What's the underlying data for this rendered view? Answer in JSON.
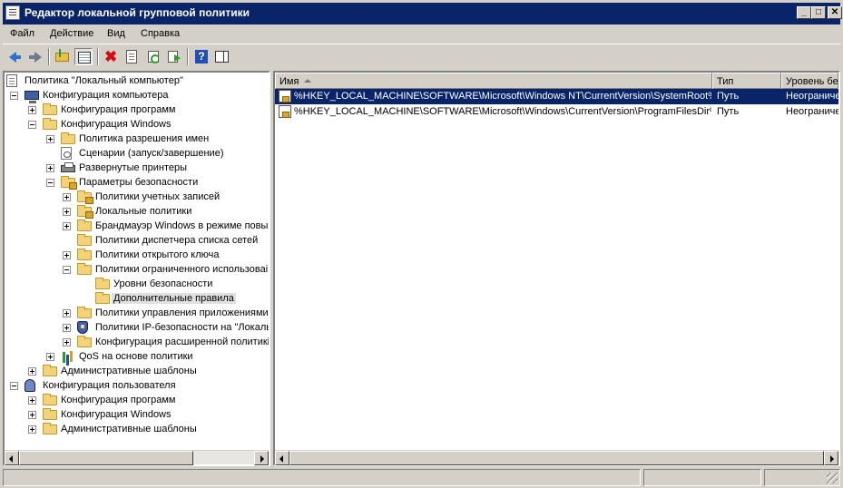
{
  "window": {
    "title": "Редактор локальной групповой политики"
  },
  "menu": {
    "items": [
      "Файл",
      "Действие",
      "Вид",
      "Справка"
    ]
  },
  "toolbar": {
    "buttons": [
      "back-icon",
      "forward-icon",
      "up-folder-icon",
      "show-hide-tree-icon",
      "delete-icon",
      "properties-icon",
      "refresh-icon",
      "export-list-icon",
      "help-icon",
      "show-action-pane-icon"
    ]
  },
  "tree": {
    "items": [
      {
        "label": "Политика \"Локальный компьютер\"",
        "icon": "policy-doc-icon"
      },
      {
        "label": "Конфигурация компьютера",
        "icon": "computer-icon",
        "expanded": true
      },
      {
        "label": "Конфигурация программ",
        "icon": "folder-icon",
        "expanded": false
      },
      {
        "label": "Конфигурация Windows",
        "icon": "folder-icon",
        "expanded": true
      },
      {
        "label": "Политика разрешения имен",
        "icon": "folder-icon",
        "expanded": false
      },
      {
        "label": "Сценарии (запуск/завершение)",
        "icon": "script-icon"
      },
      {
        "label": "Развернутые принтеры",
        "icon": "printer-icon",
        "expanded": false
      },
      {
        "label": "Параметры безопасности",
        "icon": "security-folder-icon",
        "expanded": true
      },
      {
        "label": "Политики учетных записей",
        "icon": "security-folder-icon",
        "expanded": false
      },
      {
        "label": "Локальные политики",
        "icon": "security-folder-icon",
        "expanded": false
      },
      {
        "label": "Брандмауэр Windows в режиме повыш",
        "icon": "folder-icon",
        "expanded": false
      },
      {
        "label": "Политики диспетчера списка сетей",
        "icon": "folder-icon"
      },
      {
        "label": "Политики открытого ключа",
        "icon": "folder-icon",
        "expanded": false
      },
      {
        "label": "Политики ограниченного использоваі",
        "icon": "folder-icon",
        "expanded": true
      },
      {
        "label": "Уровни безопасности",
        "icon": "folder-icon"
      },
      {
        "label": "Дополнительные правила",
        "icon": "folder-icon",
        "selected": true
      },
      {
        "label": "Политики управления приложениями",
        "icon": "folder-icon",
        "expanded": false
      },
      {
        "label": "Политики IP-безопасности на \"Локаль",
        "icon": "ipsec-shield-icon",
        "expanded": false
      },
      {
        "label": "Конфигурация расширенной политикі",
        "icon": "folder-icon",
        "expanded": false
      },
      {
        "label": "QoS на основе политики",
        "icon": "qos-chart-icon",
        "expanded": false
      },
      {
        "label": "Административные шаблоны",
        "icon": "folder-icon",
        "expanded": false
      },
      {
        "label": "Конфигурация пользователя",
        "icon": "user-icon",
        "expanded": true
      },
      {
        "label": "Конфигурация программ",
        "icon": "folder-icon",
        "expanded": false
      },
      {
        "label": "Конфигурация Windows",
        "icon": "folder-icon",
        "expanded": false
      },
      {
        "label": "Административные шаблоны",
        "icon": "folder-icon",
        "expanded": false
      }
    ]
  },
  "list": {
    "columns": [
      "Имя",
      "Тип",
      "Уровень без"
    ],
    "rows": [
      {
        "name": "%HKEY_LOCAL_MACHINE\\SOFTWARE\\Microsoft\\Windows NT\\CurrentVersion\\SystemRoot%",
        "type": "Путь",
        "level": "Неограниче",
        "selected": true
      },
      {
        "name": "%HKEY_LOCAL_MACHINE\\SOFTWARE\\Microsoft\\Windows\\CurrentVersion\\ProgramFilesDir%",
        "type": "Путь",
        "level": "Неограниче",
        "selected": false
      }
    ]
  },
  "colors": {
    "titlebar": "#0a246a",
    "selection": "#0a246a",
    "chrome": "#d4d0c8"
  }
}
